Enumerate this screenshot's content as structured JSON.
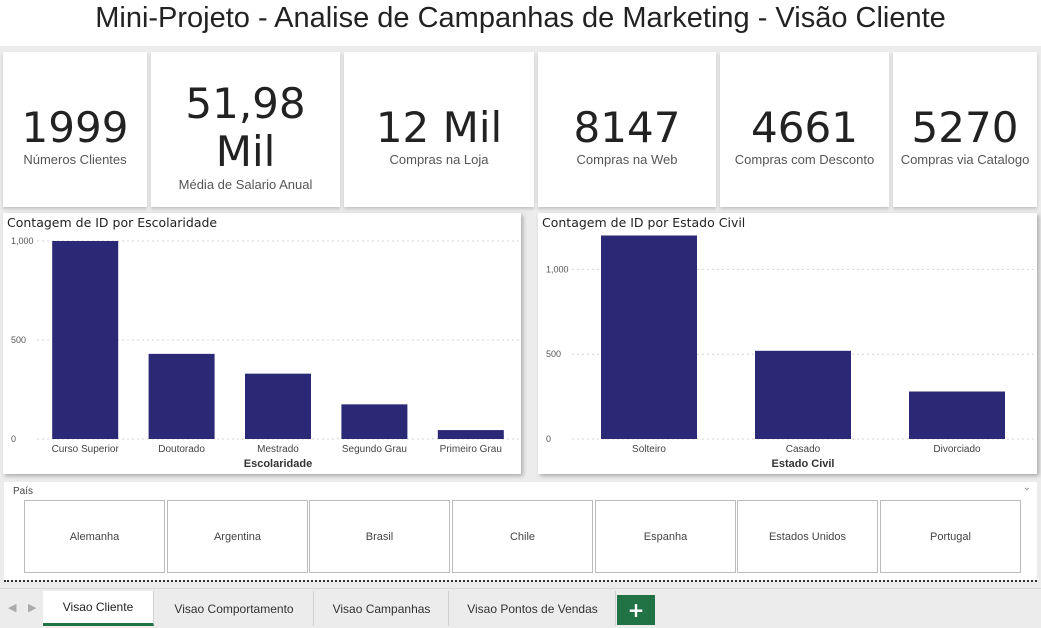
{
  "header": {
    "title": "Mini-Projeto - Analise de Campanhas de Marketing - Visão Cliente"
  },
  "kpis": [
    {
      "value": "1999",
      "label": "Números Clientes"
    },
    {
      "value": "51,98 Mil",
      "value_line1": "51,98",
      "value_line2": "Mil",
      "label": "Média de Salario Anual"
    },
    {
      "value": "12 Mil",
      "label": "Compras na Loja"
    },
    {
      "value": "8147",
      "label": "Compras na Web"
    },
    {
      "value": "4661",
      "label": "Compras com Desconto"
    },
    {
      "value": "5270",
      "label": "Compras via Catalogo"
    }
  ],
  "chart_data": [
    {
      "type": "bar",
      "title": "Contagem de ID por Escolaridade",
      "xlabel": "Escolaridade",
      "ylabel": "",
      "categories": [
        "Curso Superior",
        "Doutorado",
        "Mestrado",
        "Segundo Grau",
        "Primeiro Grau"
      ],
      "values": [
        1000,
        430,
        330,
        175,
        45
      ],
      "ylim": [
        0,
        1000
      ],
      "yticks": [
        0,
        500,
        1000
      ],
      "ytick_labels": [
        "0",
        "500",
        "1,000"
      ],
      "grid": true,
      "bar_color": "#2b2875"
    },
    {
      "type": "bar",
      "title": "Contagem de ID por Estado Civil",
      "xlabel": "Estado Civil",
      "ylabel": "",
      "categories": [
        "Solteiro",
        "Casado",
        "Divorciado"
      ],
      "values": [
        1200,
        520,
        280
      ],
      "ylim": [
        0,
        1250
      ],
      "yticks": [
        0,
        500,
        1000
      ],
      "ytick_labels": [
        "0",
        "500",
        "1,000"
      ],
      "grid": true,
      "bar_color": "#2b2875"
    }
  ],
  "slicer": {
    "title": "País",
    "items": [
      "Alemanha",
      "Argentina",
      "Brasil",
      "Chile",
      "Espanha",
      "Estados Unidos",
      "Portugal"
    ]
  },
  "tabs": {
    "items": [
      "Visao Cliente",
      "Visao Comportamento",
      "Visao Campanhas",
      "Visao Pontos de Vendas"
    ],
    "active": "Visao Cliente",
    "add_label": "+"
  },
  "colors": {
    "accent": "#217346",
    "bar": "#2b2875"
  },
  "icons": {
    "prev": "chevron-left-icon",
    "next": "chevron-right-icon",
    "dropdown": "chevron-down-icon"
  }
}
